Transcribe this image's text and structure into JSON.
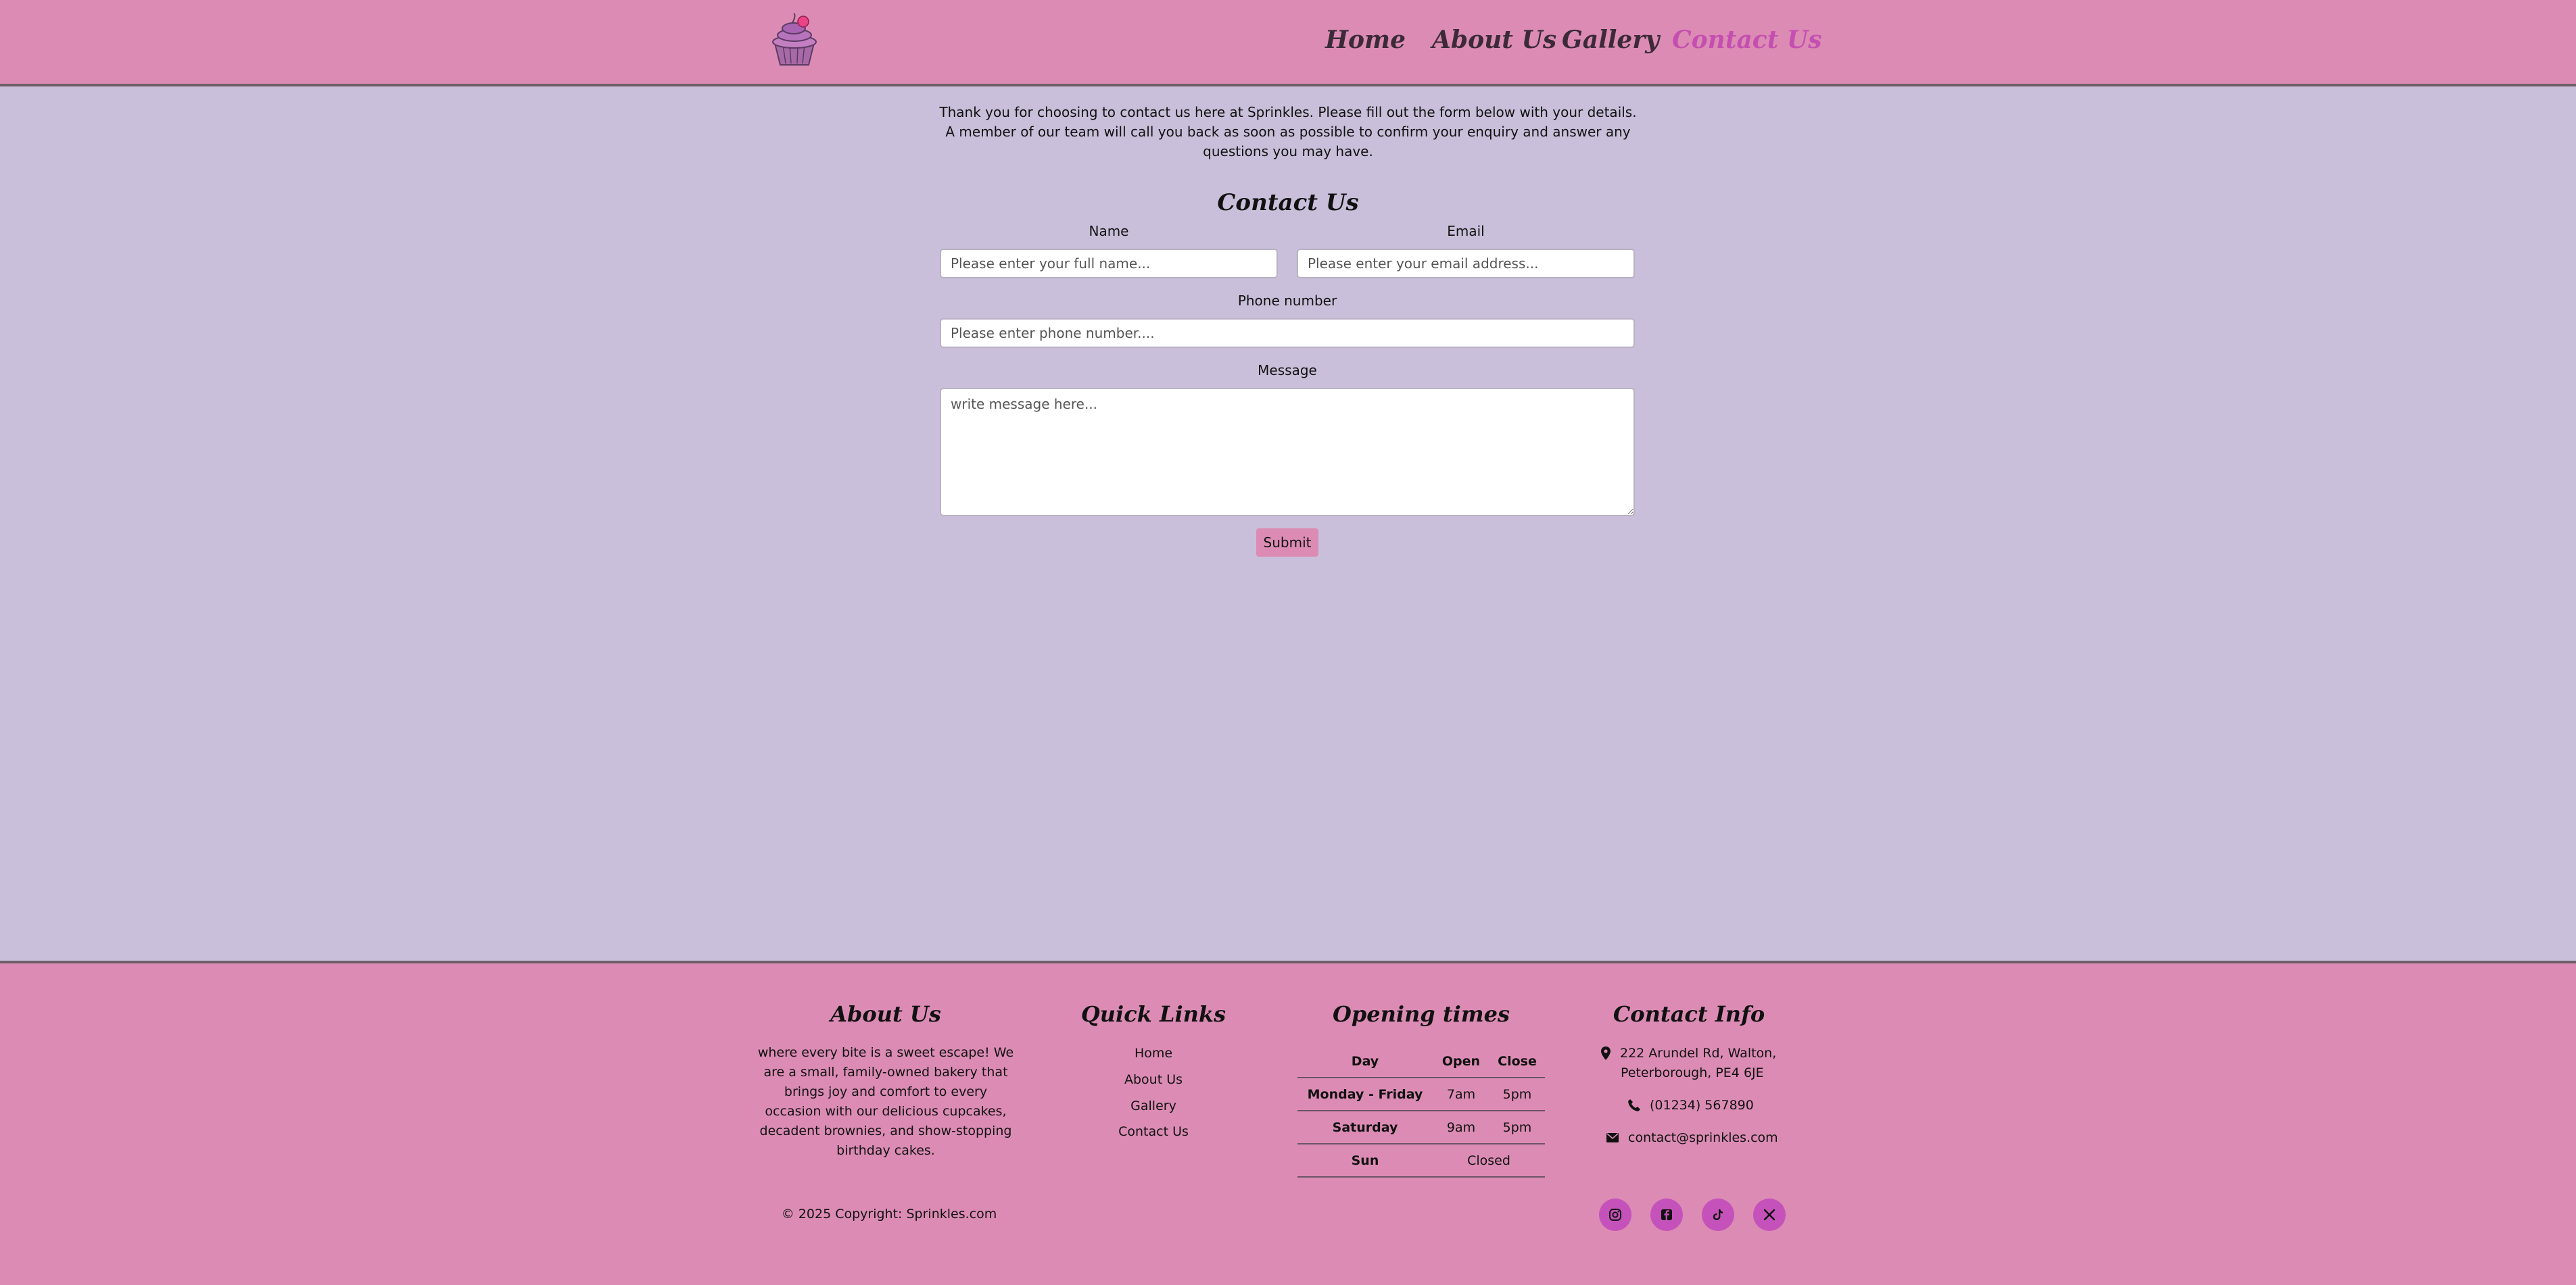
{
  "header": {
    "nav": [
      {
        "label": "Home",
        "active": false
      },
      {
        "label": "About Us",
        "active": false
      },
      {
        "label": "Gallery",
        "active": false
      },
      {
        "label": "Contact Us",
        "active": true
      }
    ],
    "logo_icon": "cupcake-logo-icon"
  },
  "main": {
    "intro_line1": "Thank you for choosing to contact us here at Sprinkles. Please fill out the form below with your details.",
    "intro_line2": "A member of our team will call you back as soon as possible to confirm your enquiry and answer any questions you may have.",
    "form_title": "Contact Us",
    "name_label": "Name",
    "name_placeholder": "Please enter your full name...",
    "email_label": "Email",
    "email_placeholder": "Please enter your email address...",
    "phone_label": "Phone number",
    "phone_placeholder": "Please enter phone number....",
    "message_label": "Message",
    "message_placeholder": "write message here...",
    "submit_label": "Submit"
  },
  "footer": {
    "about_title": "About Us",
    "about_text": "where every bite is a sweet escape! We are a small, family-owned bakery that brings joy and comfort to every occasion with our delicious cupcakes, decadent brownies, and show-stopping birthday cakes.",
    "quick_links_title": "Quick Links",
    "quick_links": [
      "Home",
      "About Us",
      "Gallery",
      "Contact Us"
    ],
    "hours_title": "Opening times",
    "hours_headers": [
      "Day",
      "Open",
      "Close"
    ],
    "hours_rows": [
      {
        "day": "Monday - Friday",
        "open": "7am",
        "close": "5pm"
      },
      {
        "day": "Saturday",
        "open": "9am",
        "close": "5pm"
      },
      {
        "day": "Sun",
        "closed": "Closed"
      }
    ],
    "contact_title": "Contact Info",
    "address_line1": "222 Arundel Rd, Walton,",
    "address_line2": "Peterborough, PE4 6JE",
    "phone": "(01234) 567890",
    "email": "contact@sprinkles.com",
    "copyright": "© 2025 Copyright: Sprinkles.com",
    "social_icons": [
      "instagram-icon",
      "facebook-icon",
      "tiktok-icon",
      "x-icon"
    ]
  },
  "colors": {
    "header_bg": "#dc8cb4",
    "page_bg": "#c9bfda",
    "active_nav": "#c54fb0",
    "social_bg": "#c552ba"
  }
}
